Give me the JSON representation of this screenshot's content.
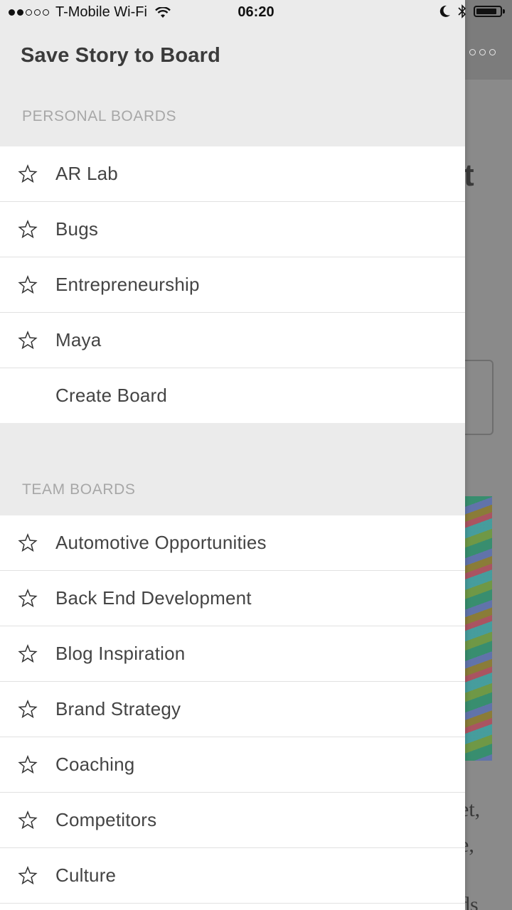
{
  "status_bar": {
    "signal": "●●○○○",
    "carrier": "T-Mobile Wi-Fi",
    "time": "06:20",
    "battery_level": 0.9
  },
  "drawer": {
    "title": "Save Story to Board",
    "personal_section": {
      "header": "PERSONAL BOARDS",
      "boards": [
        {
          "label": "AR Lab",
          "icon": "star-outline-icon"
        },
        {
          "label": "Bugs",
          "icon": "star-outline-icon"
        },
        {
          "label": "Entrepreneurship",
          "icon": "star-outline-icon"
        },
        {
          "label": "Maya",
          "icon": "star-outline-icon"
        }
      ],
      "create_label": "Create Board"
    },
    "team_section": {
      "header": "TEAM BOARDS",
      "boards": [
        {
          "label": "Automotive Opportunities",
          "icon": "star-outline-icon"
        },
        {
          "label": "Back End Development",
          "icon": "star-outline-icon"
        },
        {
          "label": "Blog Inspiration",
          "icon": "star-outline-icon"
        },
        {
          "label": "Brand Strategy",
          "icon": "star-outline-icon"
        },
        {
          "label": "Coaching",
          "icon": "star-outline-icon"
        },
        {
          "label": "Competitors",
          "icon": "star-outline-icon"
        },
        {
          "label": "Culture",
          "icon": "star-outline-icon"
        }
      ]
    }
  },
  "background": {
    "title_fragment": "t",
    "text_lines": [
      "et,",
      "e,",
      "ds"
    ],
    "more_icon": "more-dots-icon"
  },
  "colors": {
    "drawer_header_bg": "#ebebeb",
    "section_header_text": "#a7a7a7",
    "row_text": "#444444",
    "divider": "#e1e1e1",
    "overlay": "#8a8a8a"
  }
}
